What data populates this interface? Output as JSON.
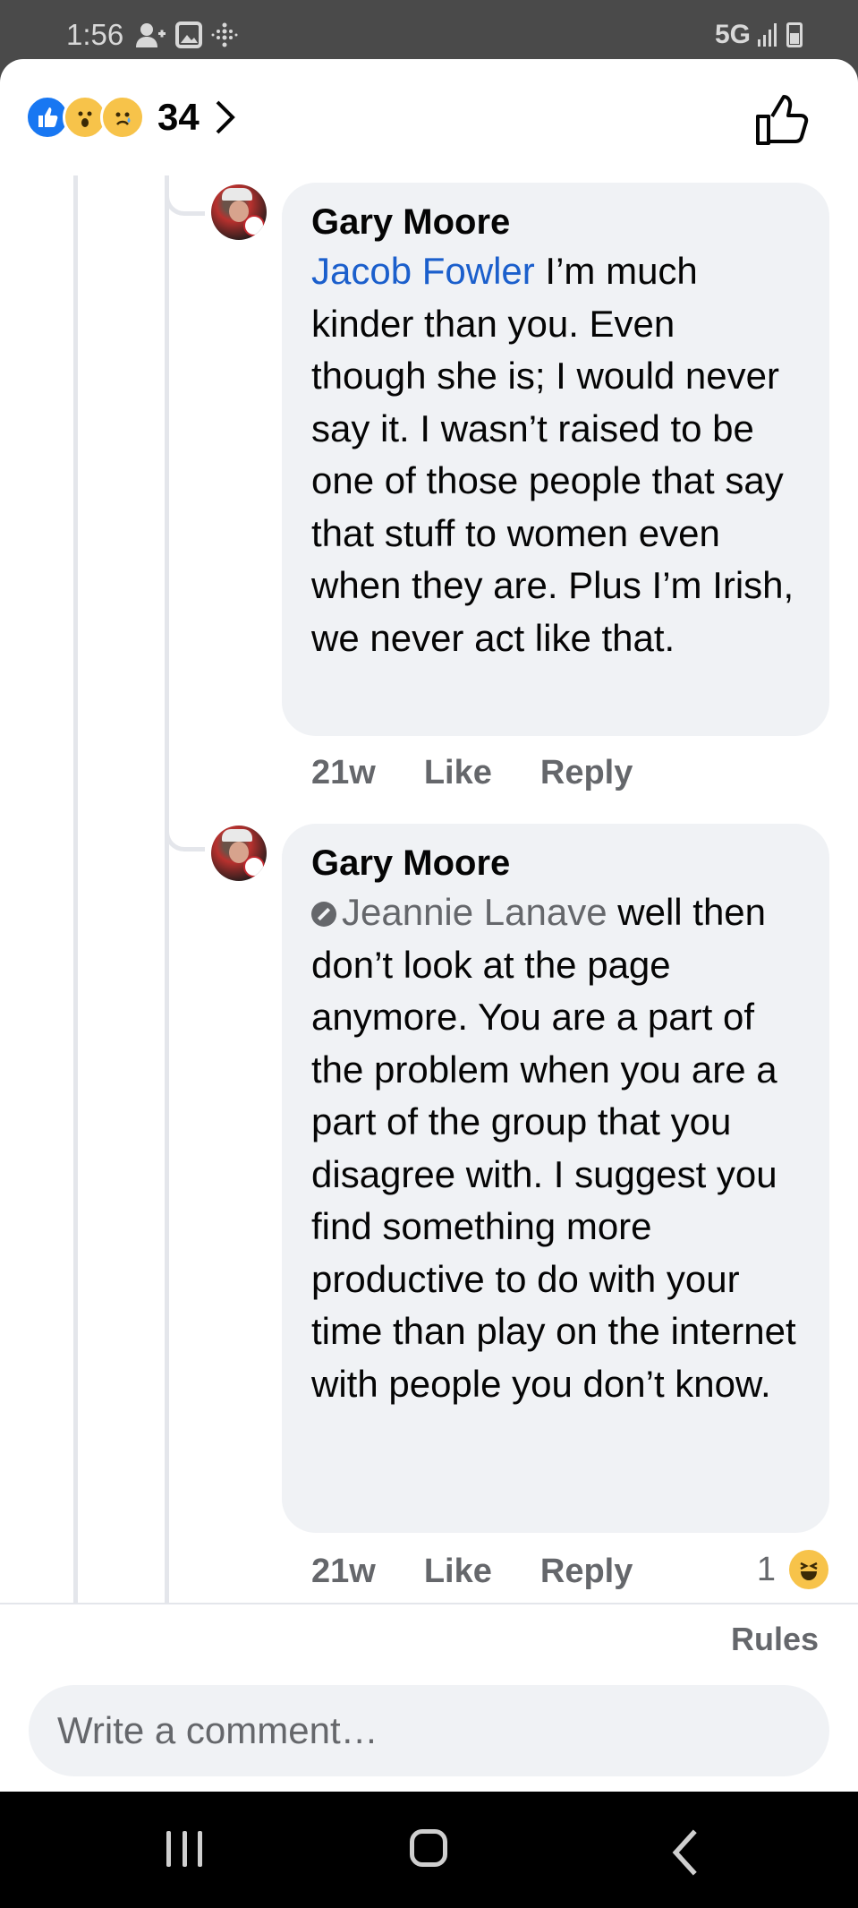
{
  "status_bar": {
    "time": "1:56",
    "network": "5G",
    "icons": [
      "add-contact-icon",
      "gallery-icon",
      "dots-grid-icon",
      "signal-icon",
      "battery-icon"
    ]
  },
  "header": {
    "reaction_count": "34",
    "reactions": [
      "like",
      "wow",
      "sad"
    ]
  },
  "comments": [
    {
      "author": "Gary Moore",
      "mention": "Jacob Fowler",
      "text": " I’m much kinder than you. Even though she is; I would never say it. I wasn’t raised to be one of those people that say that stuff to women even when they are. Plus I’m Irish, we never act like that.",
      "time": "21w",
      "like_label": "Like",
      "reply_label": "Reply"
    },
    {
      "author": "Gary Moore",
      "mention": "Jeannie Lanave",
      "text": " well then don’t look at the page anymore. You are a part of the problem when you are a part of the group that you disagree with. I suggest you find something more productive to do with your time than play on the internet with people you don’t know.",
      "time": "21w",
      "like_label": "Like",
      "reply_label": "Reply",
      "reaction_count": "1",
      "reaction": "haha"
    }
  ],
  "composer": {
    "rules_label": "Rules",
    "placeholder": "Write a comment…"
  },
  "colors": {
    "mention_blue": "#1b5fcc",
    "bubble_bg": "#f0f2f5",
    "like_blue": "#1877f2",
    "secondary_text": "#65676b"
  }
}
